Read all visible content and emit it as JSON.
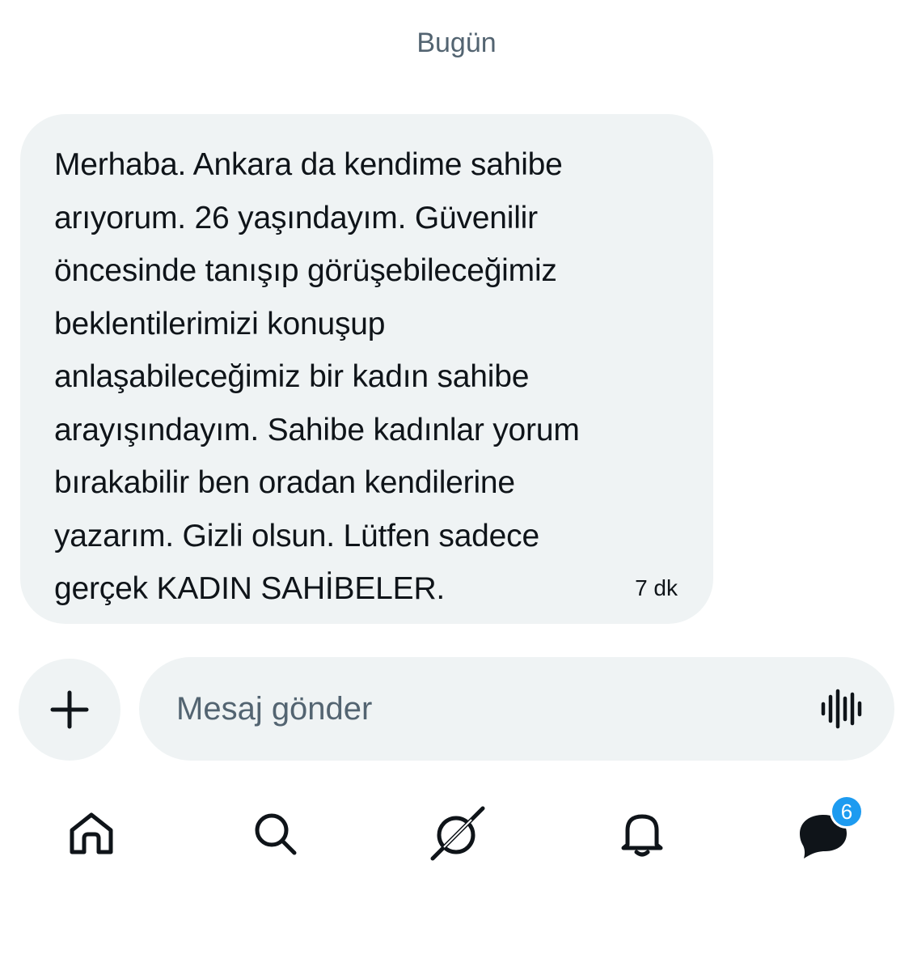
{
  "conversation": {
    "date_divider": "Bugün",
    "message": {
      "lines": [
        "Merhaba. Ankara da kendime sahibe",
        "arıyorum. 26 yaşındayım. Güvenilir",
        "öncesinde tanışıp görüşebileceğimiz",
        "beklentilerimizi konuşup",
        "anlaşabileceğimiz bir kadın sahibe",
        "arayışındayım. Sahibe kadınlar yorum",
        "bırakabilir ben oradan kendilerine",
        "yazarım. Gizli olsun. Lütfen sadece",
        "gerçek KADIN SAHİBELER."
      ],
      "time": "7 dk"
    }
  },
  "composer": {
    "plus_icon": "plus-icon",
    "placeholder": "Mesaj gönder",
    "voice_icon": "voice-waveform-icon"
  },
  "bottom_nav": {
    "items": [
      {
        "icon": "home-icon"
      },
      {
        "icon": "search-icon"
      },
      {
        "icon": "grok-icon"
      },
      {
        "icon": "bell-icon"
      },
      {
        "icon": "messages-icon",
        "badge": "6"
      }
    ]
  },
  "colors": {
    "bubble_bg": "#eff3f4",
    "text_primary": "#0f1419",
    "text_secondary": "#536471",
    "badge_bg": "#1d9bf0"
  }
}
